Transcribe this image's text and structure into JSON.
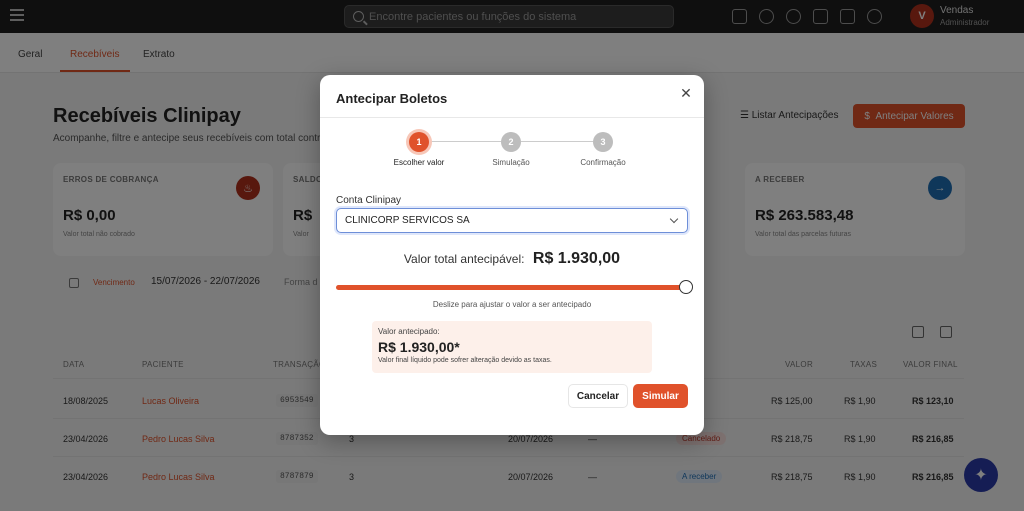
{
  "topbar": {
    "search_placeholder": "Encontre pacientes ou funções do sistema",
    "user_initial": "V",
    "user_name": "Vendas",
    "user_role": "Administrador",
    "icons": [
      "video-icon",
      "sparkle-icon",
      "headset-icon",
      "calendar-icon",
      "chat-icon",
      "bell-icon"
    ]
  },
  "tabs": [
    {
      "label": "Geral"
    },
    {
      "label": "Recebíveis",
      "active": true
    },
    {
      "label": "Extrato"
    }
  ],
  "page": {
    "title": "Recebíveis Clinipay",
    "subtitle": "Acompanhe, filtre e antecipe seus recebíveis com total controle f",
    "list_button": "Listar Antecipações",
    "anticipate_button": "Antecipar Valores"
  },
  "cards": [
    {
      "label": "ERROS DE COBRANÇA",
      "value": "R$ 0,00",
      "desc": "Valor total não cobrado",
      "icon_color": "#b0301c"
    },
    {
      "label": "SALDO",
      "value": "R$",
      "desc": "Valor",
      "icon_color": "#b0301c"
    },
    {
      "label": "A RECEBER",
      "value": "R$ 263.583,48",
      "desc": "Valor total das parcelas futuras",
      "icon_color": "#1f6fb5"
    }
  ],
  "filters": {
    "type": "Vencimento",
    "range": "15/07/2026 - 22/07/2026",
    "payment": "Forma d"
  },
  "table": {
    "headers": {
      "date": "DATA",
      "patient": "PACIENTE",
      "transaction": "TRANSAÇÃO",
      "value": "VALOR",
      "fees": "TAXAS",
      "final": "VALOR FINAL"
    },
    "rows": [
      {
        "date": "18/08/2025",
        "patient": "Lucas Oliveira",
        "transaction": "6953549",
        "value": "R$ 125,00",
        "fees": "R$ 1,90",
        "final": "R$ 123,10",
        "installment": "",
        "due": "",
        "dash": "",
        "status": ""
      },
      {
        "date": "23/04/2026",
        "patient": "Pedro Lucas Silva",
        "transaction": "8787352",
        "installment": "3",
        "due": "20/07/2026",
        "dash": "—",
        "status": "Cancelado",
        "value": "R$ 218,75",
        "fees": "R$ 1,90",
        "final": "R$ 216,85"
      },
      {
        "date": "23/04/2026",
        "patient": "Pedro Lucas Silva",
        "transaction": "8787879",
        "installment": "3",
        "due": "20/07/2026",
        "dash": "—",
        "status": "A receber",
        "value": "R$ 218,75",
        "fees": "R$ 1,90",
        "final": "R$ 216,85"
      }
    ]
  },
  "modal": {
    "title": "Antecipar Boletos",
    "steps": [
      {
        "number": "1",
        "label": "Escolher valor",
        "active": true
      },
      {
        "number": "2",
        "label": "Simulação"
      },
      {
        "number": "3",
        "label": "Confirmação"
      }
    ],
    "account_label": "Conta Clinipay",
    "account_value": "CLINICORP SERVICOS SA",
    "total_label": "Valor total antecipável:",
    "total_value": "R$ 1.930,00",
    "slider_fraction": 1.0,
    "slider_hint": "Deslize para ajustar o valor a ser antecipado",
    "summary_label": "Valor antecipado:",
    "summary_value": "R$ 1.930,00*",
    "summary_note": "Valor final líquido pode sofrer alteração devido as taxas.",
    "cancel_label": "Cancelar",
    "simulate_label": "Simular"
  },
  "colors": {
    "accent": "#e0522b",
    "overlay": "rgba(0,0,0,0.5)"
  }
}
